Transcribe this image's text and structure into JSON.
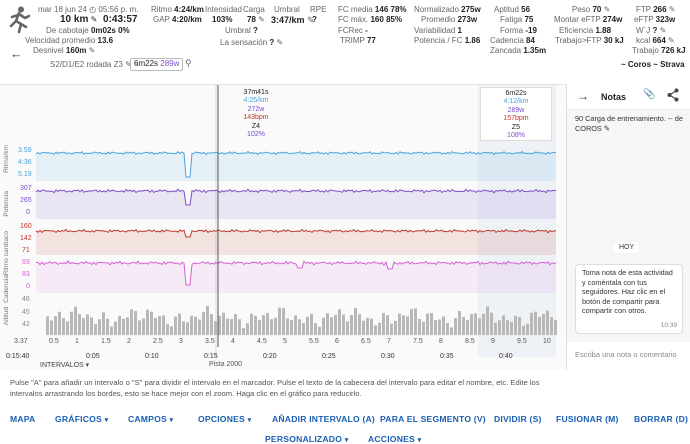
{
  "header": {
    "date": "mar 18 jun 24",
    "time_of_day": "05:56 p. m.",
    "distance": "10 km",
    "duration": "0:43:57",
    "coast_label": "De cabotaje",
    "coast_value": "0m02s",
    "coast_pct": "0%",
    "avg_speed_label": "Velocidad promedio",
    "avg_speed_value": "13.6",
    "elev_label": "Desnivel",
    "elev_value": "160m",
    "interval_name": "S2/D1/E2 rodada Z3",
    "interval_sep": "~",
    "interval_time": "6m22s",
    "interval_power": "289w",
    "pace_label": "Ritmo",
    "pace_value": "4:24/km",
    "gap_label": "GAP",
    "gap_value": "4:20/km",
    "intensity_label": "Intensidad",
    "intensity_value": "103%",
    "load_label": "Carga",
    "load_value": "78",
    "threshold_label": "Umbral",
    "threshold_value": "?",
    "threshold2_label": "Umbral",
    "threshold2_value": "3:47/km",
    "rpe_label": "RPE",
    "rpe_value": "?",
    "feel_label": "La sensación",
    "feel_value": "?",
    "hr_avg_label": "FC media",
    "hr_avg_value": "146",
    "hr_avg_pct": "78%",
    "hr_max_label": "FC máx.",
    "hr_max_value": "160",
    "hr_max_pct": "85%",
    "fcrec_label": "FCRec",
    "fcrec_value": "-",
    "trimp_label": "TRIMP",
    "trimp_value": "77",
    "norm_label": "Normalizado",
    "norm_value": "275w",
    "avgp_label": "Promedio",
    "avgp_value": "273w",
    "var_label": "Variabilidad",
    "var_value": "1",
    "pfc_label": "Potencia / FC",
    "pfc_value": "1.86",
    "apt_label": "Aptitud",
    "apt_value": "56",
    "fat_label": "Fatiga",
    "fat_value": "75",
    "form_label": "Forma",
    "form_value": "-19",
    "cad_label": "Cadencia",
    "cad_value": "84",
    "stride_label": "Zancada",
    "stride_value": "1.35m",
    "weight_label": "Peso",
    "weight_value": "70",
    "mftp_label": "Montar eFTP",
    "mftp_value": "274w",
    "eff_label": "Eficiencia",
    "eff_value": "1.88",
    "workftp_label": "Trabajo>FTP",
    "workftp_value": "30 kJ",
    "ftp_label": "FTP",
    "ftp_value": "266",
    "eftp_label": "eFTP",
    "eftp_value": "323w",
    "wbal_label": "W`J",
    "wbal_value": "?",
    "kcal_label": "kcal",
    "kcal_value": "664",
    "work_label": "Trabajo",
    "work_value": "726 kJ",
    "source": "Coros",
    "source2": "Strava",
    "source_sep": "~",
    "source_sep2": "~"
  },
  "intervals": [
    {
      "time": "37m41s",
      "pace": "4:25/km",
      "power": "272w",
      "hr": "143bpm",
      "zone": "Z4",
      "pct": "102%"
    },
    {
      "time": "6m22s",
      "pace": "4:12/km",
      "power": "289w",
      "hr": "157bpm",
      "zone": "Z5",
      "pct": "108%"
    }
  ],
  "axes": {
    "pace_title": "Ritmo/km",
    "power_title": "Potencia",
    "hr_title": "Ritmo cardíaco",
    "cad_title": "Cadencia",
    "alt_title": "Altitud",
    "pace_ticks": [
      "3.59",
      "4:36",
      "5.19"
    ],
    "power_ticks": [
      "307",
      "265",
      "0"
    ],
    "hr_ticks": [
      "160",
      "142",
      "71"
    ],
    "cad_ticks": [
      "93",
      "83",
      "0"
    ],
    "alt_ticks": [
      "46",
      "45",
      "42"
    ],
    "km_ticks": [
      "3.37",
      "0.5",
      "1",
      "1.5",
      "2",
      "2.5",
      "3",
      "3.5",
      "4",
      "4.5",
      "5",
      "5.5",
      "6",
      "6.5",
      "7",
      "7.5",
      "8",
      "8.5",
      "9",
      "9.5",
      "10"
    ],
    "time_ticks": [
      "0:15:40",
      "0:05",
      "0:10",
      "0:15",
      "0:20",
      "0:25",
      "0:30",
      "0:35",
      "0:40"
    ],
    "cursor_label": "Pista 2000",
    "intervals_label": "INTERVALOS"
  },
  "notes": {
    "title": "Notas",
    "training_note": "90 Carga de entrenamiento. -- de COROS",
    "today_badge": "HOY",
    "message": "Toma nota de esta actividad y coméntala con tus seguidores. Haz clic en el botón de compartir para compartir con otros.",
    "message_time": "10:39",
    "input_placeholder": "Escriba una nota o comentario"
  },
  "help_text": "Pulse \"A\" para añadir un intervalo o \"S\" para dividir el intervalo en el marcador. Pulse el texto de la cabecera del intervalo para editar el nombre, etc. Edite los intervalos arrastrando los bordes, esto se hace mejor con el zoom. Haga clic en el gráfico para reducirlo.",
  "menu": {
    "map": "MAPA",
    "graphs": "GRÁFICOS",
    "fields": "CAMPOS",
    "options": "OPCIONES",
    "add_interval": "AÑADIR INTERVALO (A)",
    "for_segment": "PARA EL SEGMENTO (V)",
    "split": "DIVIDIR (S)",
    "merge": "FUSIONAR (M)",
    "delete": "BORRAR (D)",
    "customize": "PERSONALIZADO",
    "actions": "ACCIONES"
  },
  "colors": {
    "pace": "#4aa3df",
    "power": "#7b4fc9",
    "hr": "#c0392b",
    "cadence": "#d65fd6",
    "altitude": "#b8b8b8",
    "accent": "#1a5fb4"
  }
}
